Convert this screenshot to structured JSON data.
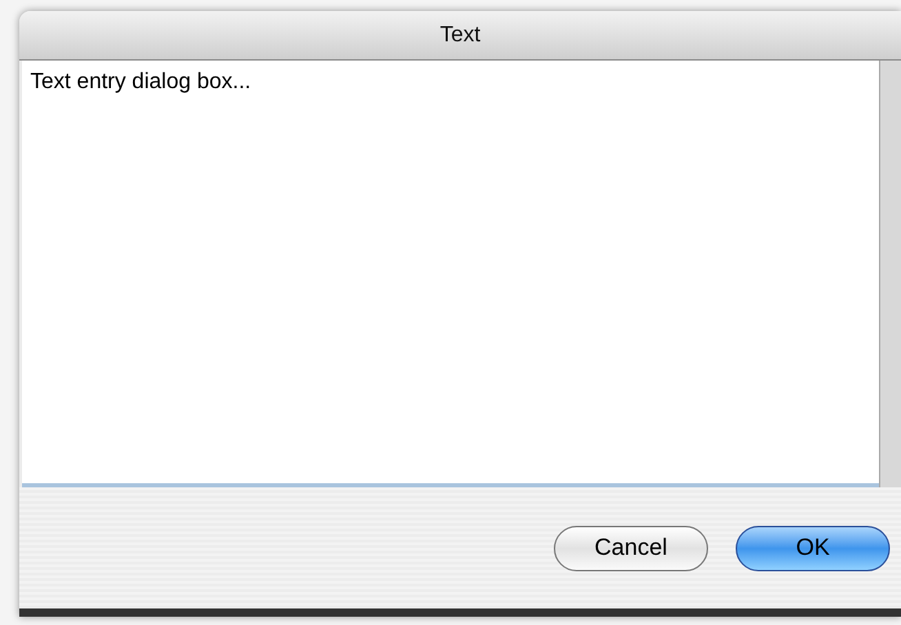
{
  "window": {
    "title": "Text"
  },
  "text_area": {
    "value": "Text entry dialog box..."
  },
  "buttons": [
    {
      "label": "Cancel",
      "default": false
    },
    {
      "label": "OK",
      "default": true
    }
  ]
}
